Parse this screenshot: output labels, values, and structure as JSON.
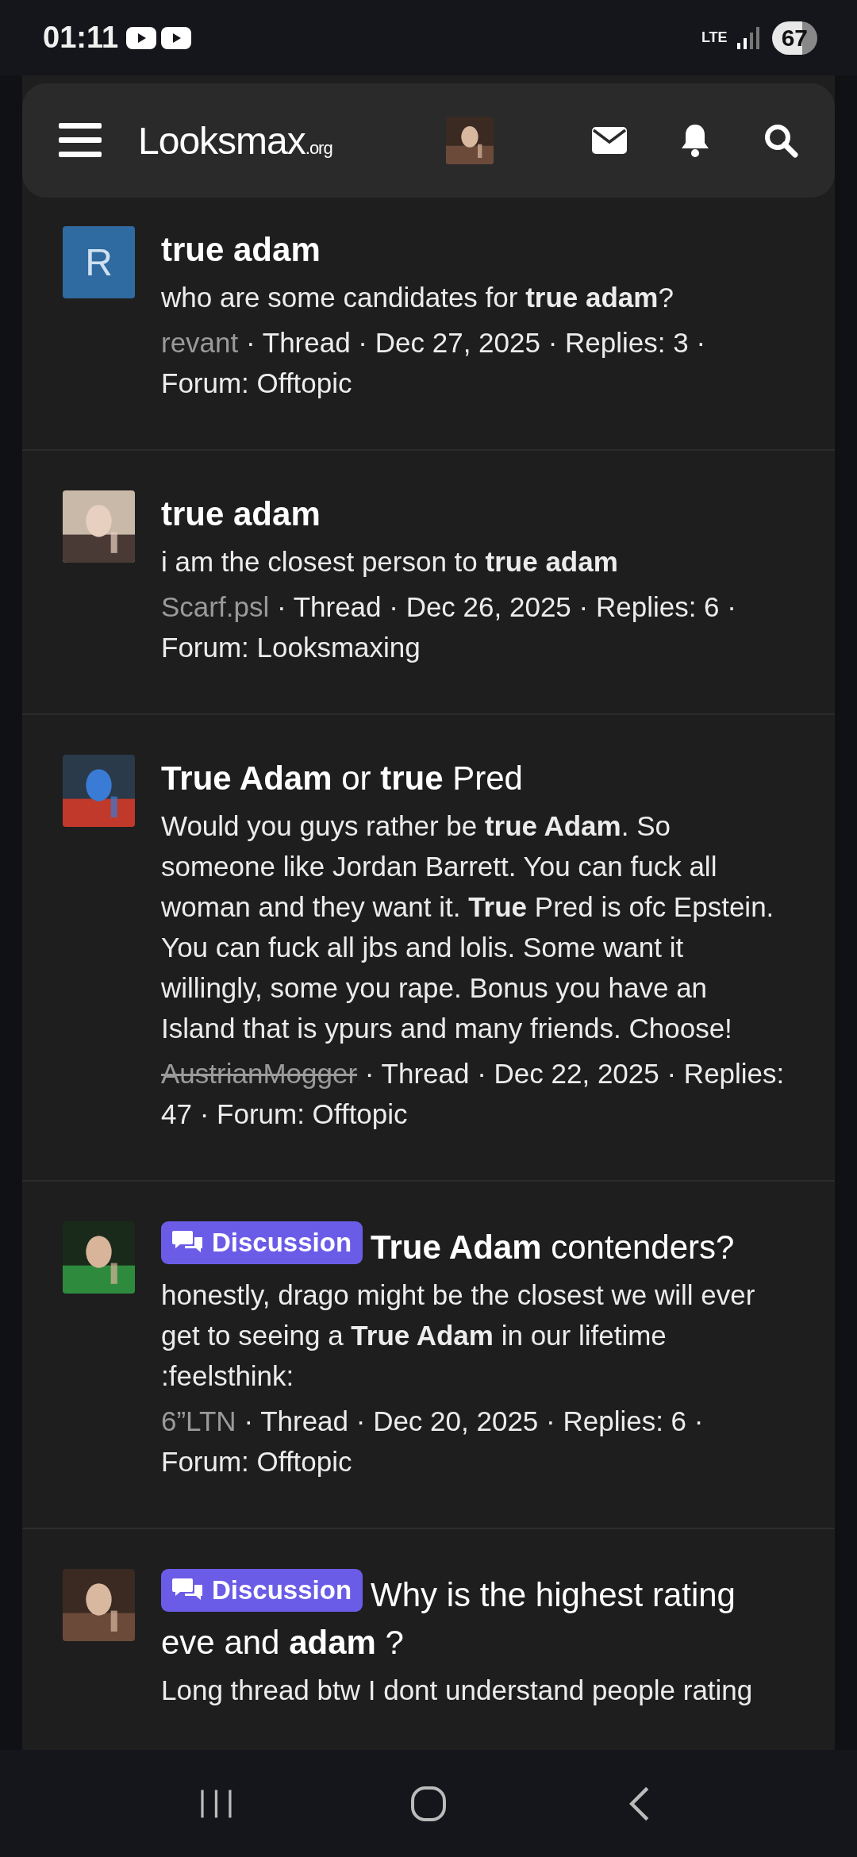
{
  "status_bar": {
    "time": "01:11",
    "network": "LTE",
    "battery": "67"
  },
  "header": {
    "logo": "Looksmax",
    "logo_suffix": ".org"
  },
  "results": [
    {
      "avatar": {
        "kind": "letter",
        "letter": "R",
        "color": "#2f6aa0"
      },
      "title": "**true adam**",
      "snippet": "who are some candidates for **true adam**?",
      "author": "revant",
      "banned": false,
      "meta": "· Thread · Dec 27, 2025 · Replies: 3 · Forum: Offtopic"
    },
    {
      "title": "**true adam**",
      "snippet": "i am the closest person to **true adam**",
      "author": "Scarf.psl",
      "banned": false,
      "meta": "· Thread · Dec 26, 2025 · Replies: 6 · Forum: Looksmaxing"
    },
    {
      "title": "**True Adam** or **true** Pred",
      "snippet": "Would you guys rather be **true Adam**. So someone like Jordan Barrett. You can fuck all woman and they want it. **True** Pred is ofc Epstein. You can fuck all jbs and lolis. Some want it willingly, some you rape. Bonus you have an Island that is ypurs and many friends. Choose!",
      "author": "AustrianMogger",
      "banned": true,
      "meta": "· Thread · Dec 22, 2025 · Replies: 47 · Forum: Offtopic"
    },
    {
      "prefix": "Discussion",
      "title": "**True Adam** contenders?",
      "snippet": "honestly, drago might be the closest we will ever get to seeing a **True Adam** in our lifetime :feelsthink:",
      "author": "6”LTN",
      "banned": false,
      "meta": "· Thread · Dec 20, 2025 · Replies: 6 · Forum: Offtopic"
    },
    {
      "prefix": "Discussion",
      "title": "Why is the highest rating eve and **adam** ?",
      "snippet": "Long thread btw I dont understand people rating"
    }
  ]
}
